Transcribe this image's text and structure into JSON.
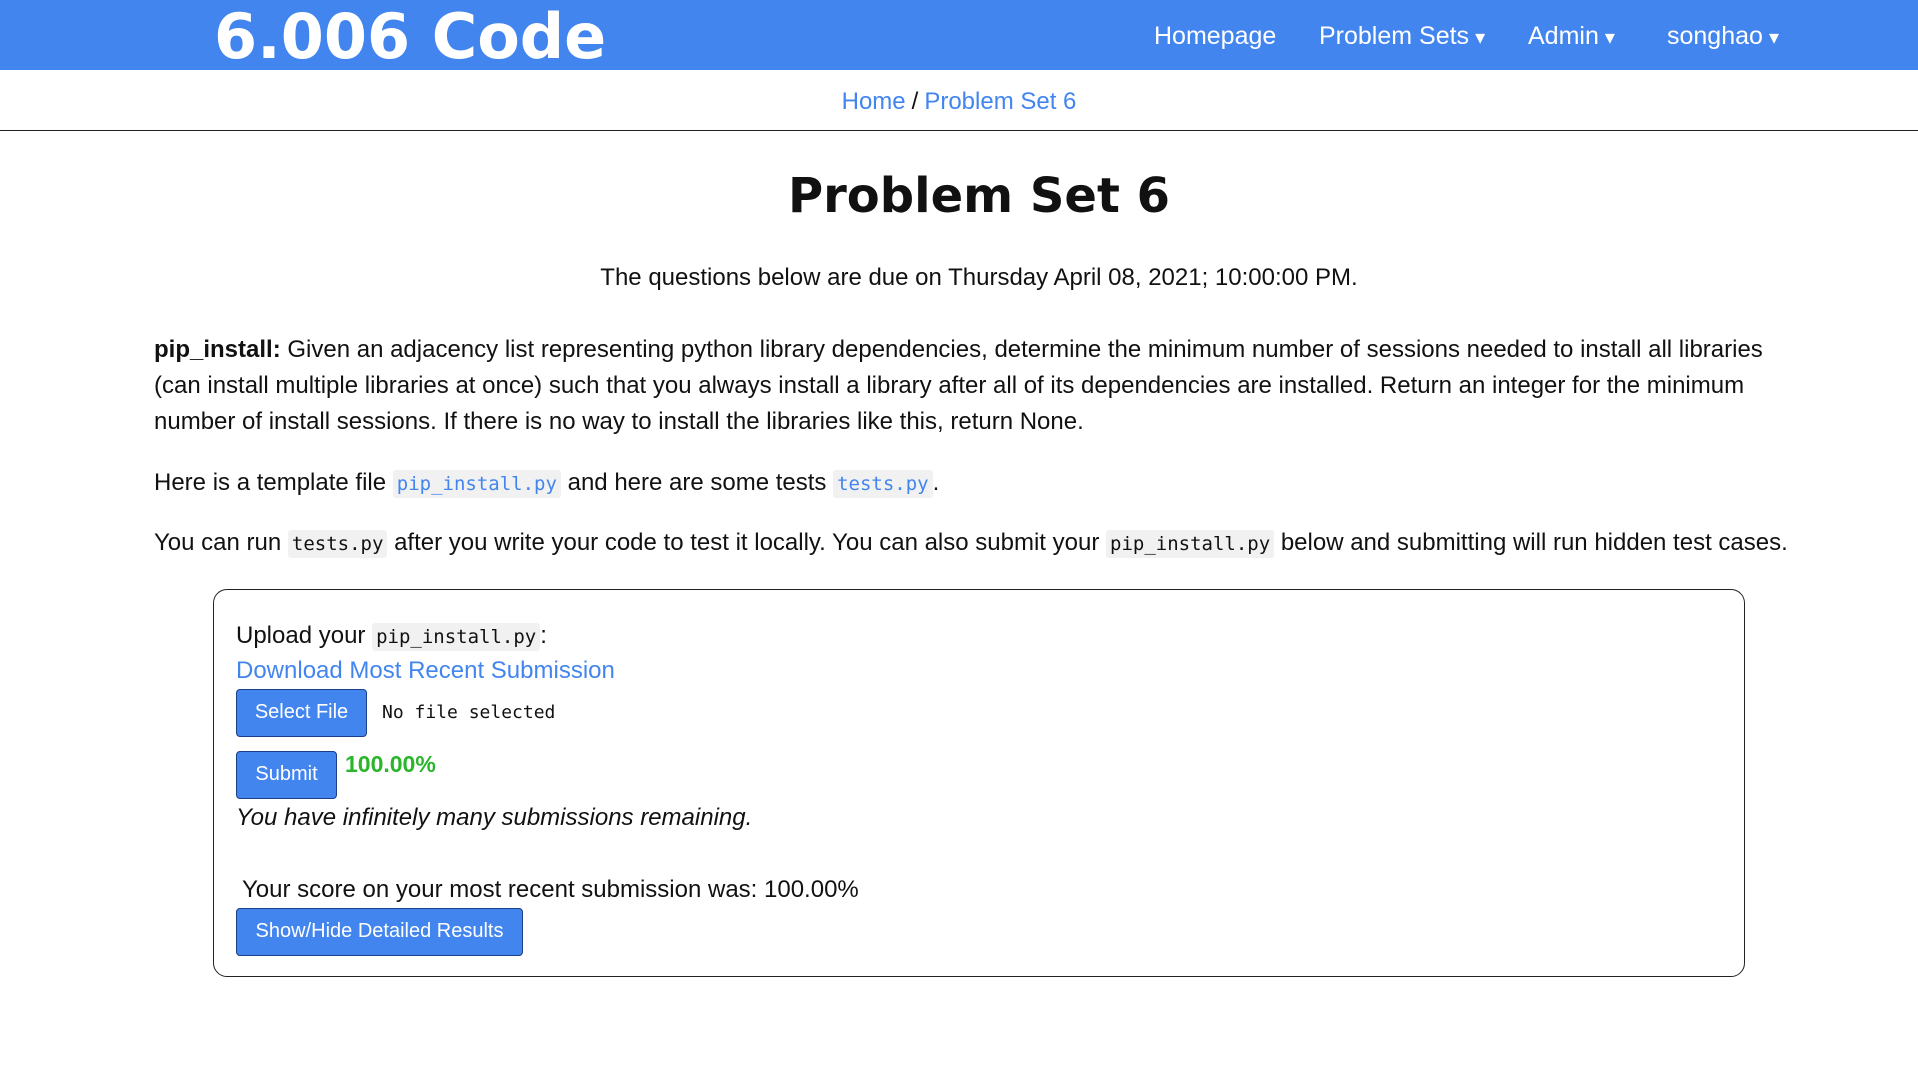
{
  "header": {
    "brand": "6.006 Code",
    "nav": [
      {
        "label": "Homepage",
        "dropdown": false
      },
      {
        "label": "Problem Sets",
        "dropdown": true
      },
      {
        "label": "Admin",
        "dropdown": true
      },
      {
        "label": "songhao",
        "dropdown": true
      }
    ],
    "caret": "▾",
    "background_color": "#4285ef"
  },
  "breadcrumb": {
    "items": [
      "Home",
      "Problem Set 6"
    ],
    "separator": "/"
  },
  "page": {
    "title": "Problem Set 6",
    "due_text": "The questions below are due on Thursday April 08, 2021; 10:00:00 PM."
  },
  "problem": {
    "name": "pip_install:",
    "description": " Given an adjacency list representing python library dependencies, determine the minimum number of sessions needed to install all libraries (can install multiple libraries at once) such that you always install a library after all of its dependencies are installed. Return an integer for the minimum number of install sessions. If there is no way to install the libraries like this, return None.",
    "template_prefix": "Here is a template file ",
    "template_file": "pip_install.py",
    "tests_mid": " and here are some tests ",
    "tests_file": "tests.py",
    "tests_suffix": ".",
    "run_prefix": "You can run ",
    "run_file": "tests.py",
    "run_mid": " after you write your code to test it locally. You can also submit your ",
    "submit_file": "pip_install.py",
    "run_suffix": " below and submitting will run hidden test cases."
  },
  "submission": {
    "upload_prefix": "Upload your ",
    "upload_file": "pip_install.py",
    "upload_suffix": ":",
    "download_link": "Download Most Recent Submission",
    "select_file_button": "Select File",
    "file_status": "No file selected",
    "submit_button": "Submit",
    "score": "100.00%",
    "remaining": "You have infinitely many submissions remaining.",
    "recent_score_text": "Your score on your most recent submission was: 100.00%",
    "details_button": "Show/Hide Detailed Results",
    "score_color": "#2ab52a"
  }
}
